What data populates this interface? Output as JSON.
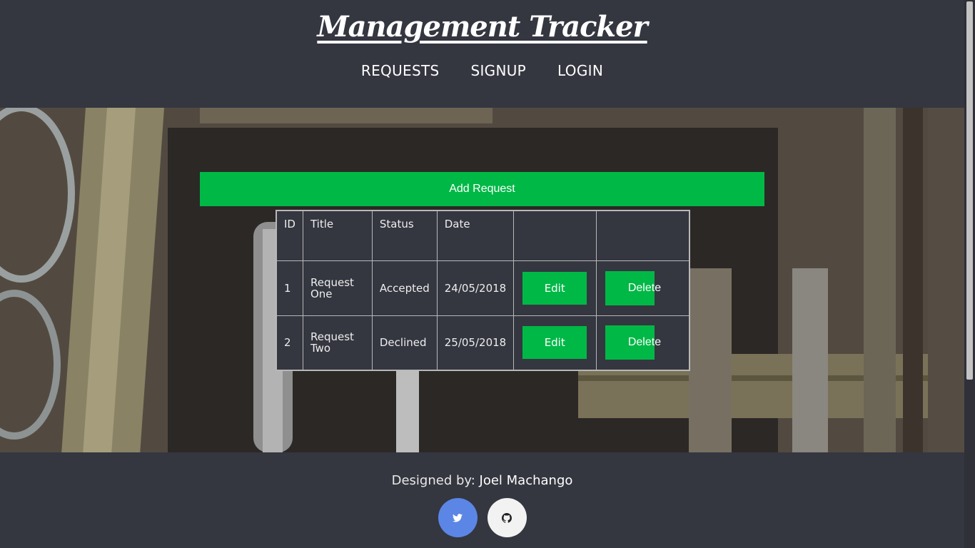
{
  "header": {
    "brand": "Management Tracker",
    "nav": [
      {
        "label": "REQUESTS"
      },
      {
        "label": "SIGNUP"
      },
      {
        "label": "LOGIN"
      }
    ]
  },
  "main": {
    "add_button_label": "Add Request",
    "table": {
      "columns": [
        "ID",
        "Title",
        "Status",
        "Date",
        "",
        ""
      ],
      "rows": [
        {
          "id": "1",
          "title_line1": "Request",
          "title_line2": "One",
          "status": "Accepted",
          "date": "24/05/2018",
          "edit_label": "Edit",
          "delete_label": "Delete"
        },
        {
          "id": "2",
          "title_line1": "Request",
          "title_line2": "Two",
          "status": "Declined",
          "date": "25/05/2018",
          "edit_label": "Edit",
          "delete_label": "Delete"
        }
      ]
    }
  },
  "footer": {
    "credit_prefix": "Designed by:",
    "author": "Joel Machango",
    "social": [
      {
        "icon": "twitter-icon",
        "color": "#5b86e5"
      },
      {
        "icon": "github-icon",
        "color": "#f2f2f2"
      }
    ]
  },
  "colors": {
    "background": "#343640",
    "accent": "#00b846"
  }
}
